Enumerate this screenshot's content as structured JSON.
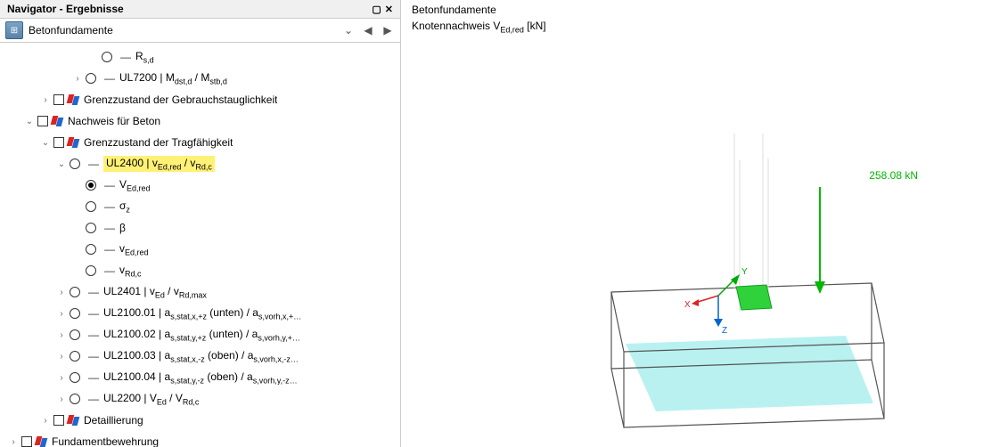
{
  "navigator": {
    "title": "Navigator - Ergebnisse",
    "toolbar_title": "Betonfundamente",
    "tree": [
      {
        "level": 5,
        "chevron": "",
        "marker": "radio",
        "label": "R<sub>s,d</sub>"
      },
      {
        "level": 4,
        "chevron": ">",
        "marker": "radio",
        "label": "UL7200 | M<sub>dst,d</sub> / M<sub>stb,d</sub>"
      },
      {
        "level": 2,
        "chevron": ">",
        "marker": "chk-flag",
        "label": "Grenzzustand der Gebrauchstauglichkeit"
      },
      {
        "level": 1,
        "chevron": "v",
        "marker": "chk-flag",
        "label": "Nachweis für Beton"
      },
      {
        "level": 2,
        "chevron": "v",
        "marker": "chk-flag",
        "label": "Grenzzustand der Tragfähigkeit"
      },
      {
        "level": 3,
        "chevron": "v",
        "marker": "radio",
        "label": "UL2400 | v<sub>Ed,red</sub> / v<sub>Rd,c</sub>",
        "highlight": true
      },
      {
        "level": 4,
        "chevron": "",
        "marker": "radio-sel",
        "label": "V<sub>Ed,red</sub>"
      },
      {
        "level": 4,
        "chevron": "",
        "marker": "radio",
        "label": "σ<sub>z</sub>"
      },
      {
        "level": 4,
        "chevron": "",
        "marker": "radio",
        "label": "β"
      },
      {
        "level": 4,
        "chevron": "",
        "marker": "radio",
        "label": "v<sub>Ed,red</sub>"
      },
      {
        "level": 4,
        "chevron": "",
        "marker": "radio",
        "label": "v<sub>Rd,c</sub>"
      },
      {
        "level": 3,
        "chevron": ">",
        "marker": "radio",
        "label": "UL2401 | v<sub>Ed</sub> / v<sub>Rd,max</sub>"
      },
      {
        "level": 3,
        "chevron": ">",
        "marker": "radio",
        "label": "UL2100.01 | a<sub>s,stat,x,+z</sub> (unten) / a<sub>s,vorh,x,+…</sub>"
      },
      {
        "level": 3,
        "chevron": ">",
        "marker": "radio",
        "label": "UL2100.02 | a<sub>s,stat,y,+z</sub> (unten) / a<sub>s,vorh,y,+…</sub>"
      },
      {
        "level": 3,
        "chevron": ">",
        "marker": "radio",
        "label": "UL2100.03 | a<sub>s,stat,x,-z</sub> (oben) / a<sub>s,vorh,x,-z…</sub>"
      },
      {
        "level": 3,
        "chevron": ">",
        "marker": "radio",
        "label": "UL2100.04 | a<sub>s,stat,y,-z</sub> (oben) / a<sub>s,vorh,y,-z…</sub>"
      },
      {
        "level": 3,
        "chevron": ">",
        "marker": "radio",
        "label": "UL2200 | V<sub>Ed</sub> / V<sub>Rd,c</sub>"
      },
      {
        "level": 2,
        "chevron": ">",
        "marker": "chk-flag",
        "label": "Detaillierung"
      },
      {
        "level": 0,
        "chevron": ">",
        "marker": "chk-flag",
        "label": "Fundamentbewehrung"
      }
    ]
  },
  "viewport": {
    "title": "Betonfundamente",
    "subtitle": "Knotennachweis V<sub>Ed,red</sub> [kN]",
    "force_value": "258.08 kN",
    "axes": {
      "x": "X",
      "y": "Y",
      "z": "Z"
    }
  }
}
